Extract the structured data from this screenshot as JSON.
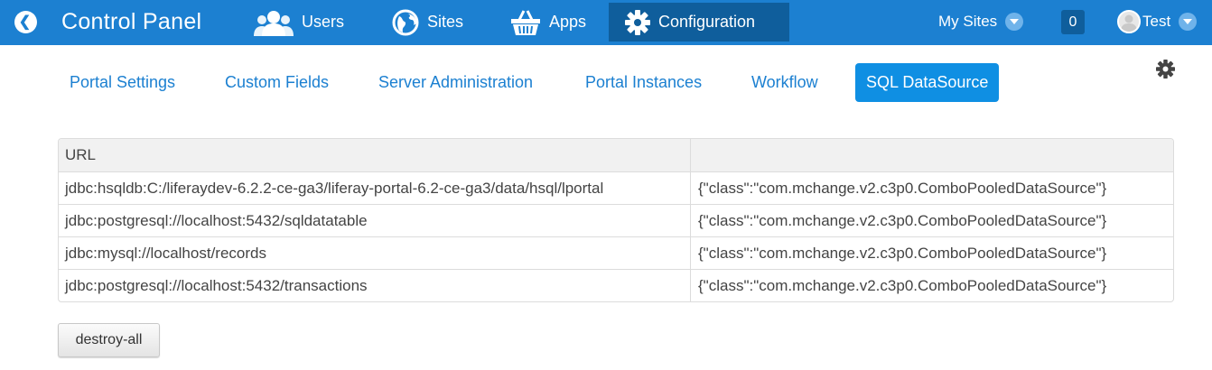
{
  "topbar": {
    "title": "Control Panel",
    "nav": [
      {
        "label": "Users",
        "icon": "users-icon"
      },
      {
        "label": "Sites",
        "icon": "globe-icon"
      },
      {
        "label": "Apps",
        "icon": "basket-icon"
      },
      {
        "label": "Configuration",
        "icon": "gear-icon",
        "active": true
      }
    ],
    "my_sites": "My Sites",
    "notification_count": "0",
    "user_name": "Test",
    "colors": {
      "bar": "#1c80d1",
      "active": "#0f5e9c"
    }
  },
  "subnav": {
    "items": [
      {
        "label": "Portal Settings"
      },
      {
        "label": "Custom Fields"
      },
      {
        "label": "Server Administration"
      },
      {
        "label": "Portal Instances"
      },
      {
        "label": "Workflow"
      },
      {
        "label": "SQL DataSource",
        "active": true
      }
    ]
  },
  "table": {
    "columns": [
      "URL",
      ""
    ],
    "rows": [
      [
        "jdbc:hsqldb:C:/liferaydev-6.2.2-ce-ga3/liferay-portal-6.2-ce-ga3/data/hsql/lportal",
        "{\"class\":\"com.mchange.v2.c3p0.ComboPooledDataSource\"}"
      ],
      [
        "jdbc:postgresql://localhost:5432/sqldatatable",
        "{\"class\":\"com.mchange.v2.c3p0.ComboPooledDataSource\"}"
      ],
      [
        "jdbc:mysql://localhost/records",
        "{\"class\":\"com.mchange.v2.c3p0.ComboPooledDataSource\"}"
      ],
      [
        "jdbc:postgresql://localhost:5432/transactions",
        "{\"class\":\"com.mchange.v2.c3p0.ComboPooledDataSource\"}"
      ]
    ]
  },
  "actions": {
    "destroy_all_label": "destroy-all"
  }
}
